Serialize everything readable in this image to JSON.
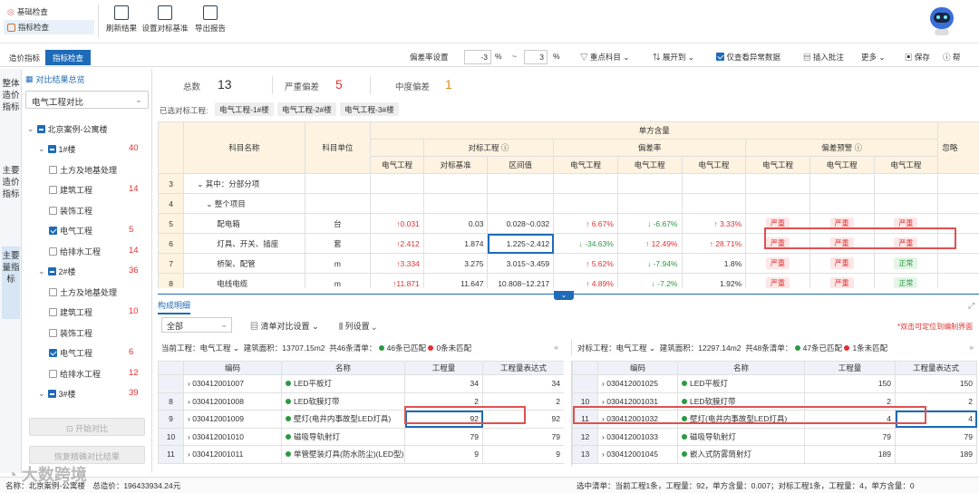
{
  "modules": {
    "basic": "基础检查",
    "index": "指标检查"
  },
  "toolbar": {
    "refresh": "刷新结果",
    "set_base": "设置对标基准",
    "export": "导出报告"
  },
  "tabs2": {
    "cost": "造价指标",
    "index": "指标检查"
  },
  "filters": {
    "dev_label": "偏差率设置",
    "dev_min": "-3",
    "pct1": "%",
    "tilde": "~",
    "dev_max": "3",
    "pct2": "%",
    "key_subject": "重点科目",
    "expand": "展开到",
    "only_abnormal": "仅查看异常数据",
    "insert_note": "插入批注",
    "more": "更多",
    "save": "保存",
    "help": "帮"
  },
  "left_tabs": [
    "整体造价指标",
    "主要造价指标",
    "主要量指标"
  ],
  "tree": {
    "title": "对比结果总览",
    "select": "电气工程对比",
    "items": [
      {
        "label": "北京案例-公寓楼",
        "count": ""
      },
      {
        "label": "1#楼",
        "count": "40"
      },
      {
        "label": "土方及地基处理",
        "count": ""
      },
      {
        "label": "建筑工程",
        "count": "14"
      },
      {
        "label": "装饰工程",
        "count": ""
      },
      {
        "label": "电气工程",
        "count": "5"
      },
      {
        "label": "给排水工程",
        "count": "14"
      },
      {
        "label": "2#楼",
        "count": "36"
      },
      {
        "label": "土方及地基处理",
        "count": ""
      },
      {
        "label": "建筑工程",
        "count": "10"
      },
      {
        "label": "装饰工程",
        "count": ""
      },
      {
        "label": "电气工程",
        "count": "6"
      },
      {
        "label": "给排水工程",
        "count": "12"
      },
      {
        "label": "3#楼",
        "count": "39"
      }
    ],
    "start_btn": "开始对比",
    "restore_btn": "恢复精确对比结果"
  },
  "summary": {
    "total_label": "总数",
    "total": "13",
    "severe_label": "严重偏差",
    "severe": "5",
    "medium_label": "中度偏差",
    "medium": "1"
  },
  "selected": {
    "label": "已选对标工程:",
    "chips": [
      "电气工程-1#楼",
      "电气工程-2#楼",
      "电气工程-3#楼"
    ]
  },
  "table": {
    "h_name": "科目名称",
    "h_unit": "科目单位",
    "h_group": "单方含量",
    "h_bench": "对标工程",
    "h_dev": "偏差率",
    "h_warn": "偏差预警",
    "h_extra": "忽略",
    "sub": [
      "电气工程",
      "对标基准",
      "区间值",
      "电气工程",
      "电气工程",
      "电气工程",
      "电气工程",
      "电气工程",
      "电气工程"
    ],
    "rows": [
      {
        "n": "3",
        "name": "其中：分部分项",
        "unit": "",
        "v1": "",
        "b": "",
        "r": "",
        "d1": "",
        "d2": "",
        "d3": "",
        "w1": "",
        "w2": "",
        "w3": ""
      },
      {
        "n": "4",
        "name": "整个项目",
        "unit": "",
        "v1": "",
        "b": "",
        "r": "",
        "d1": "",
        "d2": "",
        "d3": "",
        "w1": "",
        "w2": "",
        "w3": ""
      },
      {
        "n": "5",
        "name": "配电箱",
        "unit": "台",
        "v1": "0.031",
        "b": "0.03",
        "r": "0.028~0.032",
        "d1": "6.67%",
        "d2": "-6.67%",
        "d3": "3.33%",
        "w1": "严重",
        "w2": "严重",
        "w3": "严重"
      },
      {
        "n": "6",
        "name": "灯具、开关、插座",
        "unit": "套",
        "v1": "2.412",
        "b": "1.874",
        "r": "1.225~2.412",
        "d1": "-34.63%",
        "d2": "12.49%",
        "d3": "28.71%",
        "w1": "严重",
        "w2": "严重",
        "w3": "严重"
      },
      {
        "n": "7",
        "name": "桥架、配管",
        "unit": "m",
        "v1": "3.334",
        "b": "3.275",
        "r": "3.015~3.459",
        "d1": "5.62%",
        "d2": "-7.94%",
        "d3": "1.8%",
        "w1": "严重",
        "w2": "严重",
        "w3": "正常"
      },
      {
        "n": "8",
        "name": "电线电缆",
        "unit": "m",
        "v1": "11.871",
        "b": "11.647",
        "r": "10.808~12.217",
        "d1": "4.89%",
        "d2": "-7.2%",
        "d3": "1.92%",
        "w1": "严重",
        "w2": "严重",
        "w3": "正常"
      }
    ]
  },
  "bottom": {
    "tab": "构成明细",
    "select": "全部",
    "compare_set": "清单对比设置",
    "col_set": "列设置",
    "hint": "*双击可定位到编制界面",
    "left_info": {
      "cur": "当前工程：电气工程",
      "area": "建筑面积：13707.15m2",
      "total": "共46条清单：",
      "matched": "46条已匹配",
      "unmatched": "0条未匹配"
    },
    "right_info": {
      "cur": "对标工程：电气工程",
      "area": "建筑面积：12297.14m2",
      "total": "共48条清单：",
      "matched": "47条已匹配",
      "unmatched": "1条未匹配"
    },
    "cols": {
      "code": "编码",
      "name": "名称",
      "qty": "工程量",
      "expr": "工程量表达式"
    },
    "left_rows": [
      {
        "n": "",
        "code": "030412001007",
        "name": "LED平板灯",
        "q": "34",
        "e": "34"
      },
      {
        "n": "8",
        "code": "030412001008",
        "name": "LED软膜灯带",
        "q": "2",
        "e": "2"
      },
      {
        "n": "9",
        "code": "030412001009",
        "name": "壁灯(电井内事故型LED灯具)",
        "q": "92",
        "e": "92"
      },
      {
        "n": "10",
        "code": "030412001010",
        "name": "磁吸导轨射灯",
        "q": "79",
        "e": "79"
      },
      {
        "n": "11",
        "code": "030412001011",
        "name": "单管壁装灯具(防水防尘)(LED型)",
        "q": "9",
        "e": "9"
      }
    ],
    "right_rows": [
      {
        "n": "",
        "code": "030412001025",
        "name": "LED平板灯",
        "q": "150",
        "e": "150"
      },
      {
        "n": "10",
        "code": "030412001031",
        "name": "LED软膜灯带",
        "q": "2",
        "e": "2"
      },
      {
        "n": "11",
        "code": "030412001032",
        "name": "壁灯(电井内事故型LED灯具)",
        "q": "4",
        "e": "4"
      },
      {
        "n": "12",
        "code": "030412001033",
        "name": "磁吸导轨射灯",
        "q": "79",
        "e": "79"
      },
      {
        "n": "13",
        "code": "030412001045",
        "name": "嵌入式防雾筒射灯",
        "q": "189",
        "e": "189"
      }
    ]
  },
  "status": {
    "left": "名称：北京案例-公寓楼　总造价：196433934.24元",
    "right": "选中清单：当前工程1条，工程量：92，单方含量：0.007；对标工程1条，工程量：4，单方含量：0",
    "watermark": "大数跨境"
  }
}
